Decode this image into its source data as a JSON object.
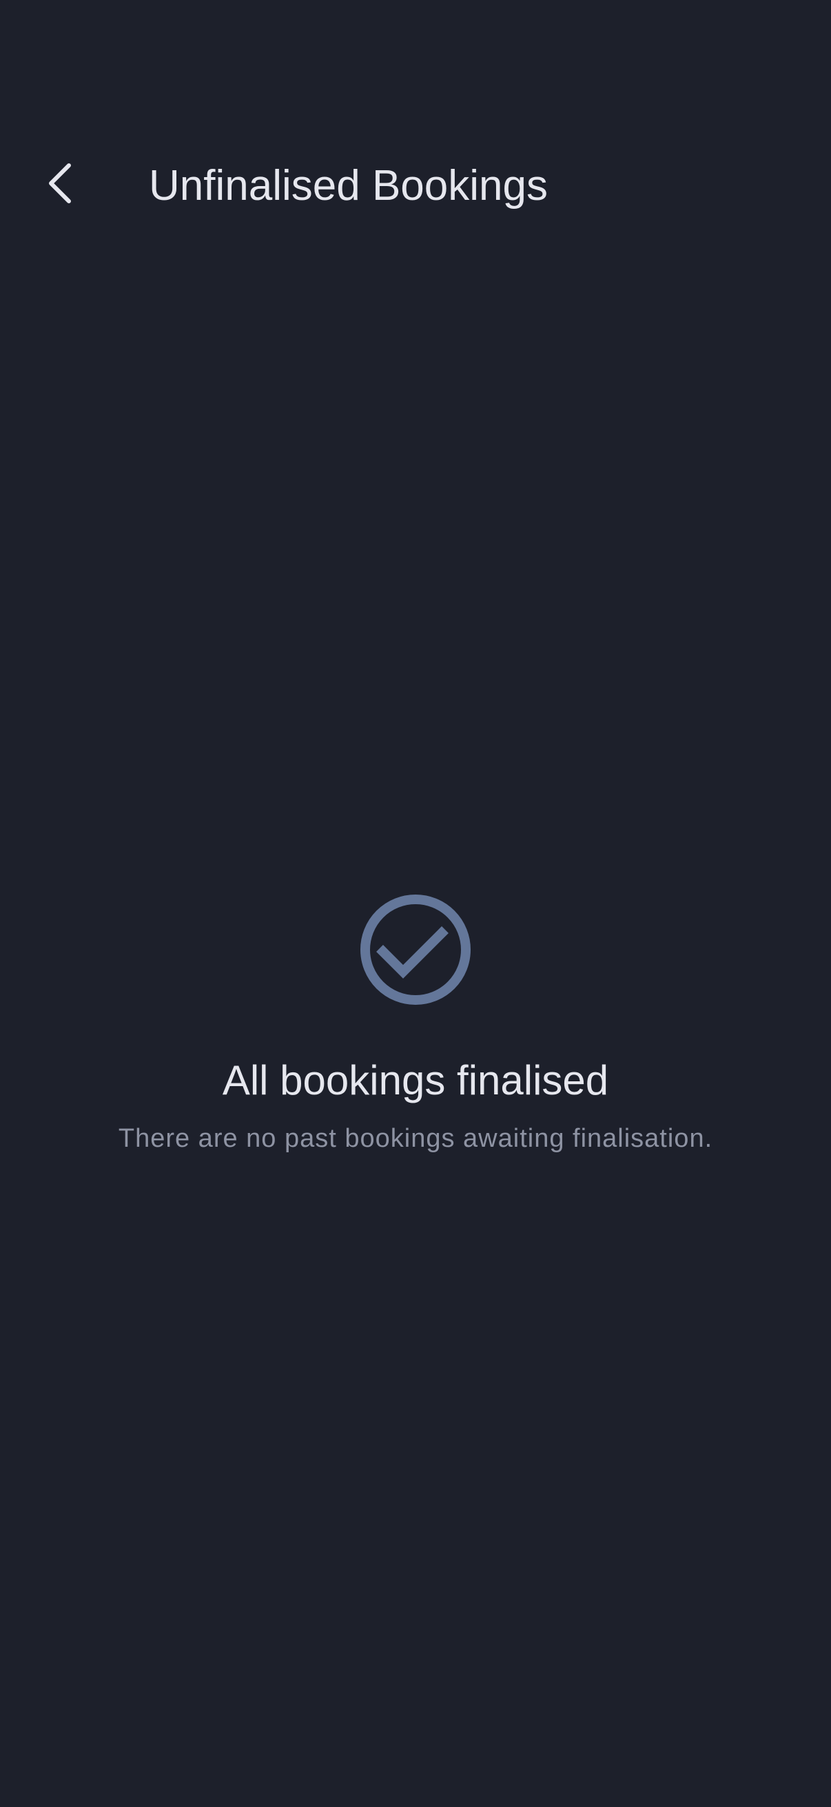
{
  "header": {
    "back_icon": "chevron-left-icon",
    "title": "Unfinalised Bookings"
  },
  "empty_state": {
    "icon": "check-circle-icon",
    "icon_color": "#64779a",
    "title": "All bookings finalised",
    "subtitle": "There are no past bookings awaiting finalisation."
  },
  "colors": {
    "background": "#1d202b",
    "primary_text": "#e6e7ee",
    "secondary_text": "#8e93a3"
  }
}
